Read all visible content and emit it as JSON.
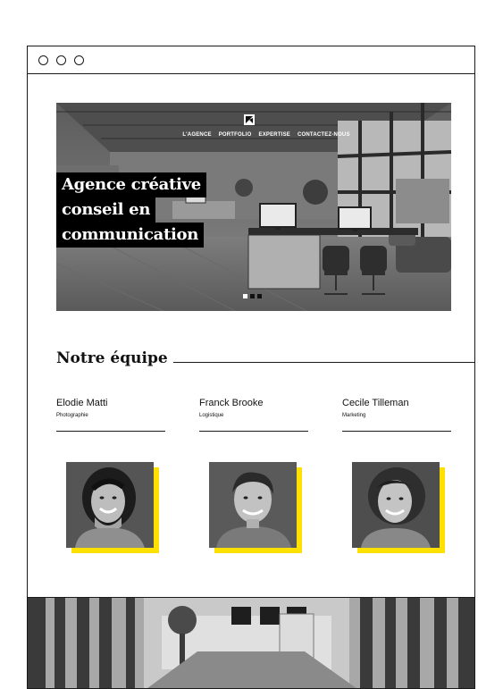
{
  "window": {
    "controls": [
      "window-dot",
      "window-dot",
      "window-dot"
    ]
  },
  "hero": {
    "nav": [
      "L'AGENCE",
      "PORTFOLIO",
      "EXPERTISE",
      "CONTACTEZ-NOUS"
    ],
    "headline_lines": [
      "Agence créative",
      "conseil en",
      "communication"
    ],
    "slides": {
      "count": 3,
      "active": 1
    }
  },
  "team": {
    "title": "Notre équipe",
    "members": [
      {
        "name": "Elodie Matti",
        "role": "Photographie"
      },
      {
        "name": "Franck Brooke",
        "role": "Logistique"
      },
      {
        "name": "Cecile Tilleman",
        "role": "Marketing"
      }
    ]
  },
  "colors": {
    "accent": "#ffe000",
    "ink": "#111111",
    "border": "#1a1a1a"
  }
}
